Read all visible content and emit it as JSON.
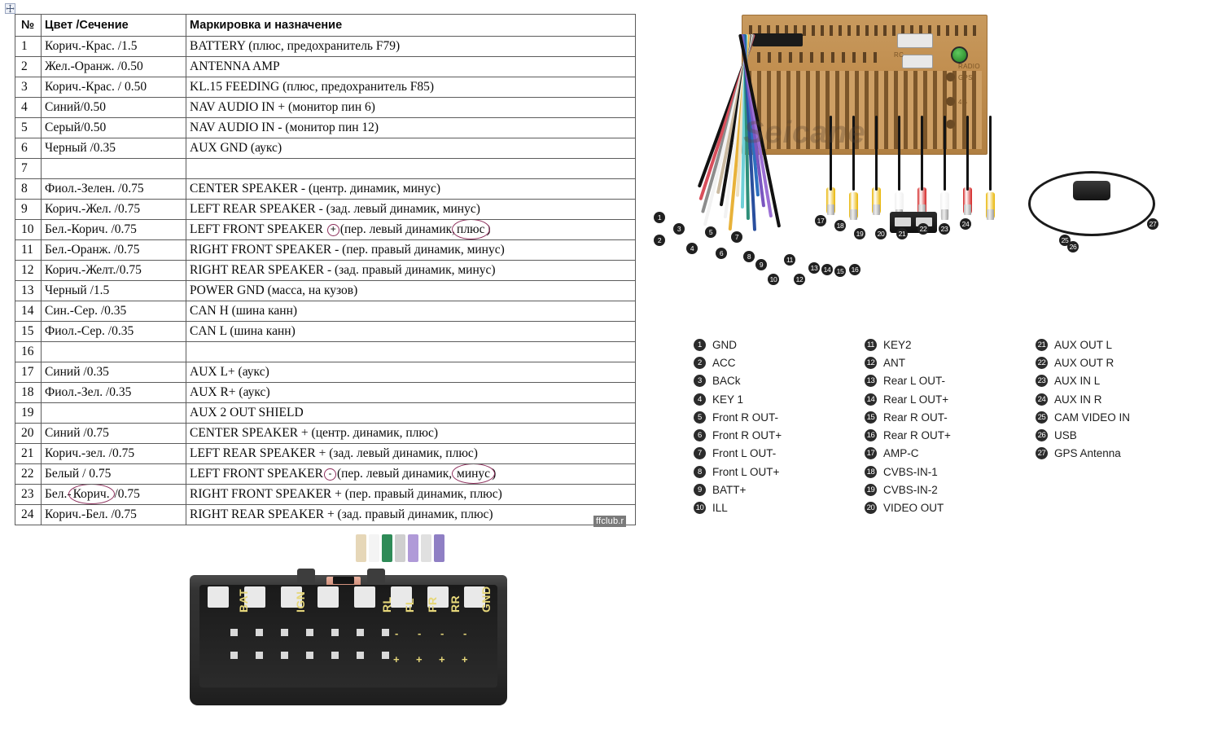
{
  "table": {
    "move_handle_icon": "move-cross-icon",
    "headers": {
      "num": "№",
      "color": "Цвет /Сечение",
      "marking": "Маркировка и назначение"
    },
    "rows": [
      {
        "num": "1",
        "color": "Корич.-Крас. /1.5",
        "marking": "BATTERY (плюс, предохранитель F79)"
      },
      {
        "num": "2",
        "color": "Жел.-Оранж. /0.50",
        "marking": "ANTENNA AMP"
      },
      {
        "num": "3",
        "color": "Корич.-Крас. / 0.50",
        "marking": "KL.15 FEEDING (плюс, предохранитель F85)"
      },
      {
        "num": "4",
        "color": "Синий/0.50",
        "marking": "NAV AUDIO IN + (монитор пин 6)"
      },
      {
        "num": "5",
        "color": "Серый/0.50",
        "marking": "NAV AUDIO IN - (монитор пин 12)"
      },
      {
        "num": "6",
        "color": "Черный /0.35",
        "marking": "AUX GND (аукс)"
      },
      {
        "num": "7",
        "color": "",
        "marking": ""
      },
      {
        "num": "8",
        "color": "Фиол.-Зелен. /0.75",
        "marking": "CENTER SPEAKER - (центр. динамик, минус)"
      },
      {
        "num": "9",
        "color": "Корич.-Жел. /0.75",
        "marking": "LEFT REAR SPEAKER - (зад. левый динамик, минус)"
      },
      {
        "num": "10",
        "color": "Бел.-Корич. /0.75",
        "marking": "LEFT FRONT SPEAKER ⊕ (пер. левый динамик, плюс)",
        "marking_parts": {
          "pre": "LEFT FRONT SPEAKER ",
          "symbol": "+",
          "mid": "(пер. левый динамик,",
          "circled": "плюс",
          "post": ")"
        }
      },
      {
        "num": "11",
        "color": "Бел.-Оранж. /0.75",
        "marking": "RIGHT FRONT SPEAKER - (пер. правый динамик, минус)"
      },
      {
        "num": "12",
        "color": "Корич.-Желт./0.75",
        "marking": "RIGHT REAR SPEAKER - (зад. правый динамик, минус)"
      },
      {
        "num": "13",
        "color": "Черный /1.5",
        "marking": "POWER GND (масса, на кузов)"
      },
      {
        "num": "14",
        "color": "Син.-Сер. /0.35",
        "marking": "CAN H (шина канн)"
      },
      {
        "num": "15",
        "color": "Фиол.-Сер. /0.35",
        "marking": "CAN L (шина канн)"
      },
      {
        "num": "16",
        "color": "",
        "marking": ""
      },
      {
        "num": "17",
        "color": "Синий /0.35",
        "marking": "AUX L+ (аукс)"
      },
      {
        "num": "18",
        "color": "Фиол.-Зел. /0.35",
        "marking": "AUX R+ (аукс)"
      },
      {
        "num": "19",
        "color": "",
        "marking": "AUX 2 OUT SHIELD"
      },
      {
        "num": "20",
        "color": "Синий /0.75",
        "marking": "CENTER SPEAKER + (центр. динамик, плюс)"
      },
      {
        "num": "21",
        "color": "Корич.-зел. /0.75",
        "marking": "LEFT REAR SPEAKER + (зад. левый динамик, плюс)"
      },
      {
        "num": "22",
        "color": "Белый / 0.75",
        "marking": "LEFT FRONT SPEAKER ⊖ (пер. левый динамик, минус)",
        "marking_parts": {
          "pre": "LEFT FRONT SPEAKER",
          "symbol": "-",
          "mid": "(пер. левый динамик, ",
          "circled": "минус",
          "post": ")"
        }
      },
      {
        "num": "23",
        "color": "Бел.-Корич. /0.75",
        "marking": "RIGHT FRONT SPEAKER + (пер. правый динамик, плюс)",
        "color_parts": {
          "pre": "Бел.-",
          "circled": "Корич.",
          "post": " /0.75"
        }
      },
      {
        "num": "24",
        "color": "Корич.-Бел. /0.75",
        "marking": "RIGHT REAR SPEAKER + (зад. правый динамик, плюс)"
      }
    ],
    "annotation_color": "#8d2f5c"
  },
  "watermarks": {
    "table_site": "ffclub.r",
    "photo_brand": "Seicane"
  },
  "legend": {
    "columns": [
      [
        {
          "n": "1",
          "label": "GND"
        },
        {
          "n": "2",
          "label": "ACC"
        },
        {
          "n": "3",
          "label": "BACk"
        },
        {
          "n": "4",
          "label": "KEY 1"
        },
        {
          "n": "5",
          "label": "Front R OUT-"
        },
        {
          "n": "6",
          "label": "Front R OUT+"
        },
        {
          "n": "7",
          "label": "Front L OUT-"
        },
        {
          "n": "8",
          "label": "Front L OUT+"
        },
        {
          "n": "9",
          "label": "BATT+"
        },
        {
          "n": "10",
          "label": "ILL"
        }
      ],
      [
        {
          "n": "11",
          "label": "KEY2"
        },
        {
          "n": "12",
          "label": "ANT"
        },
        {
          "n": "13",
          "label": "Rear L OUT-"
        },
        {
          "n": "14",
          "label": "Rear L OUT+"
        },
        {
          "n": "15",
          "label": "Rear R OUT-"
        },
        {
          "n": "16",
          "label": "Rear R OUT+"
        },
        {
          "n": "17",
          "label": "AMP-C"
        },
        {
          "n": "18",
          "label": "CVBS-IN-1"
        },
        {
          "n": "19",
          "label": "CVBS-IN-2"
        },
        {
          "n": "20",
          "label": "VIDEO OUT"
        }
      ],
      [
        {
          "n": "21",
          "label": "AUX OUT L"
        },
        {
          "n": "22",
          "label": "AUX OUT R"
        },
        {
          "n": "23",
          "label": "AUX IN L"
        },
        {
          "n": "24",
          "label": "AUX IN R"
        },
        {
          "n": "25",
          "label": "CAM VIDEO IN"
        },
        {
          "n": "26",
          "label": "USB"
        },
        {
          "n": "27",
          "label": "GPS Antenna"
        }
      ]
    ]
  },
  "headunit_photo": {
    "panel_labels": [
      "RADIO",
      "GPS",
      "4G",
      "RC"
    ],
    "harness_callouts": [
      "1",
      "2",
      "3",
      "4",
      "5",
      "6",
      "7",
      "8",
      "9",
      "10",
      "11",
      "12",
      "13",
      "14",
      "15",
      "16"
    ],
    "rca_callouts": [
      "17",
      "18",
      "19",
      "20",
      "21",
      "22",
      "23",
      "24",
      "25",
      "26",
      "27"
    ],
    "harness_wire_colors": [
      "#111111",
      "#d94f5c",
      "#8c8c8c",
      "#f2f2f2",
      "#c9b9a0",
      "#111111",
      "#f2f2f2",
      "#e8b23a",
      "#efe3c8",
      "#6fd0d8",
      "#2f8f7a",
      "#2a4f9e",
      "#2d6fbf",
      "#7a56c0",
      "#9b6fd4",
      "#111111"
    ],
    "rca_colors": [
      "#e8b400",
      "#e8b400",
      "#e8b400",
      "#f0f0f0",
      "#d22020",
      "#f0f0f0",
      "#d22020",
      "#e8b400"
    ]
  },
  "connector_photo": {
    "labels_top": [
      "BAT",
      "IGN",
      "RL",
      "FL",
      "FR",
      "RR",
      "GND"
    ],
    "minus_sign": "-",
    "plus_sign": "+",
    "speaker_pairs": [
      "RL",
      "FL",
      "FR",
      "RR"
    ],
    "wire_colors": [
      "#e6d7b8",
      "#f4f4f4",
      "#2e8b57",
      "#cfcfcf",
      "#b09ad8",
      "#e0e0e0",
      "#8f7fc4"
    ]
  }
}
